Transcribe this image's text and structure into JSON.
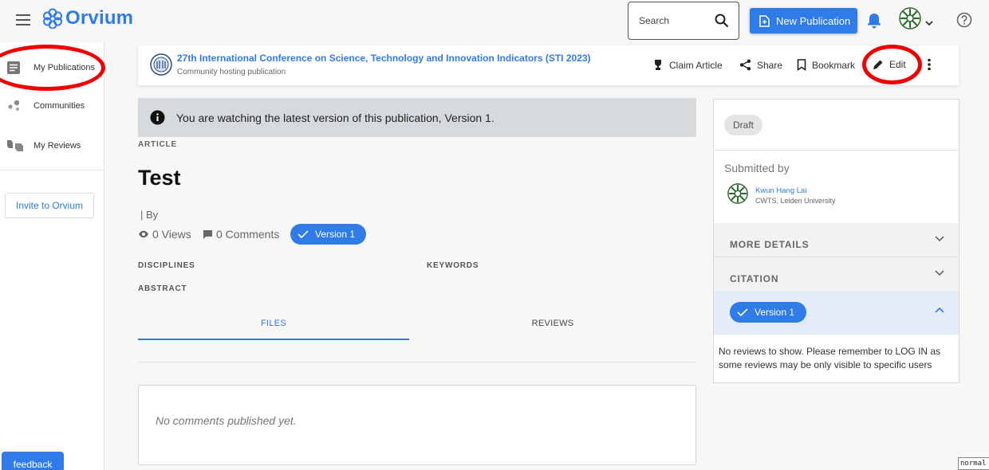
{
  "topbar": {
    "brand": "Orvium",
    "search_placeholder": "Search",
    "new_publication_label": "New Publication",
    "status_text": "normal"
  },
  "sidebar": {
    "items": [
      {
        "label": "My Publications",
        "icon": "article-icon"
      },
      {
        "label": "Communities",
        "icon": "communities-icon"
      },
      {
        "label": "My Reviews",
        "icon": "reviews-icon"
      }
    ],
    "invite_label": "Invite to Orvium",
    "feedback_label": "feedback"
  },
  "publication_header": {
    "community_title": "27th International Conference on Science, Technology and Innovation Indicators (STI 2023)",
    "community_subtitle": "Community hosting publication",
    "actions": {
      "claim": "Claim Article",
      "share": "Share",
      "bookmark": "Bookmark",
      "edit": "Edit"
    }
  },
  "main": {
    "notice": "You are watching the latest version of this publication, Version 1.",
    "type_label": "ARTICLE",
    "title": "Test",
    "by_label": "| By",
    "views": "0 Views",
    "comments": "0 Comments",
    "version_chip": "Version 1",
    "disciplines_label": "DISCIPLINES",
    "keywords_label": "KEYWORDS",
    "abstract_label": "ABSTRACT",
    "tabs": [
      {
        "label": "FILES",
        "active": true
      },
      {
        "label": "REVIEWS",
        "active": false
      }
    ],
    "no_comments": "No comments published yet."
  },
  "right_panel": {
    "status": "Draft",
    "submitted_by_label": "Submitted by",
    "author_name": "Kwun Hang Lai",
    "author_affiliation": "CWTS, Leiden University",
    "more_details_label": "MORE DETAILS",
    "citation_label": "CITATION",
    "version_chip": "Version 1",
    "no_reviews_text": "No reviews to show. Please remember to LOG IN as some reviews may be only visible to specific users"
  },
  "colors": {
    "accent": "#2f7be8",
    "annotation": "#f20000",
    "notice_bg": "#d7dadd"
  }
}
